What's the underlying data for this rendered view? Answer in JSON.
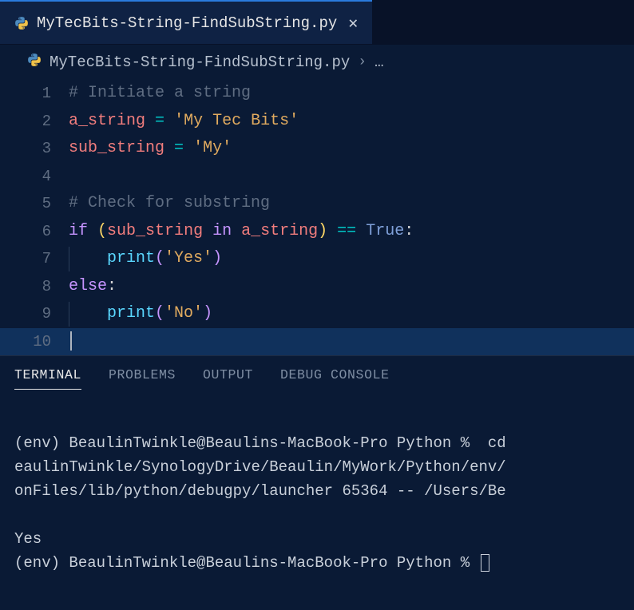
{
  "tab": {
    "filename": "MyTecBits-String-FindSubString.py",
    "language_icon": "python-icon"
  },
  "breadcrumb": {
    "filename": "MyTecBits-String-FindSubString.py",
    "chevron": "›",
    "ellipsis": "…"
  },
  "editor": {
    "cursor_line": 10,
    "lines": [
      {
        "n": "1",
        "tokens": [
          [
            "# Initiate a string",
            "c-comment"
          ]
        ]
      },
      {
        "n": "2",
        "tokens": [
          [
            "a_string",
            "c-var"
          ],
          [
            " ",
            ""
          ],
          [
            "=",
            "c-op"
          ],
          [
            " ",
            ""
          ],
          [
            "'My Tec Bits'",
            "c-str"
          ]
        ]
      },
      {
        "n": "3",
        "tokens": [
          [
            "sub_string",
            "c-var"
          ],
          [
            " ",
            ""
          ],
          [
            "=",
            "c-op"
          ],
          [
            " ",
            ""
          ],
          [
            "'My'",
            "c-str"
          ]
        ]
      },
      {
        "n": "4",
        "tokens": []
      },
      {
        "n": "5",
        "tokens": [
          [
            "# Check for substring",
            "c-comment"
          ]
        ]
      },
      {
        "n": "6",
        "tokens": [
          [
            "if",
            "c-kw"
          ],
          [
            " ",
            ""
          ],
          [
            "(",
            "c-paren"
          ],
          [
            "sub_string",
            "c-var"
          ],
          [
            " ",
            ""
          ],
          [
            "in",
            "c-kw"
          ],
          [
            " ",
            ""
          ],
          [
            "a_string",
            "c-var"
          ],
          [
            ")",
            "c-paren"
          ],
          [
            " ",
            ""
          ],
          [
            "==",
            "c-op"
          ],
          [
            " ",
            ""
          ],
          [
            "True",
            "c-const"
          ],
          [
            ":",
            ""
          ]
        ]
      },
      {
        "n": "7",
        "indent": 4,
        "guide": true,
        "tokens": [
          [
            "print",
            "c-func"
          ],
          [
            "(",
            "c-paren2"
          ],
          [
            "'Yes'",
            "c-str"
          ],
          [
            ")",
            "c-paren2"
          ]
        ]
      },
      {
        "n": "8",
        "tokens": [
          [
            "else",
            "c-kw"
          ],
          [
            ":",
            ""
          ]
        ]
      },
      {
        "n": "9",
        "indent": 4,
        "guide": true,
        "tokens": [
          [
            "print",
            "c-func"
          ],
          [
            "(",
            "c-paren2"
          ],
          [
            "'No'",
            "c-str"
          ],
          [
            ")",
            "c-paren2"
          ]
        ]
      },
      {
        "n": "10",
        "tokens": []
      }
    ]
  },
  "panel": {
    "tabs": [
      "TERMINAL",
      "PROBLEMS",
      "OUTPUT",
      "DEBUG CONSOLE"
    ],
    "active_tab": 0,
    "terminal_lines": [
      "",
      "(env) BeaulinTwinkle@Beaulins-MacBook-Pro Python %  cd",
      "eaulinTwinkle/SynologyDrive/Beaulin/MyWork/Python/env/",
      "onFiles/lib/python/debugpy/launcher 65364 -- /Users/Be",
      "",
      "Yes",
      "(env) BeaulinTwinkle@Beaulins-MacBook-Pro Python % "
    ]
  }
}
